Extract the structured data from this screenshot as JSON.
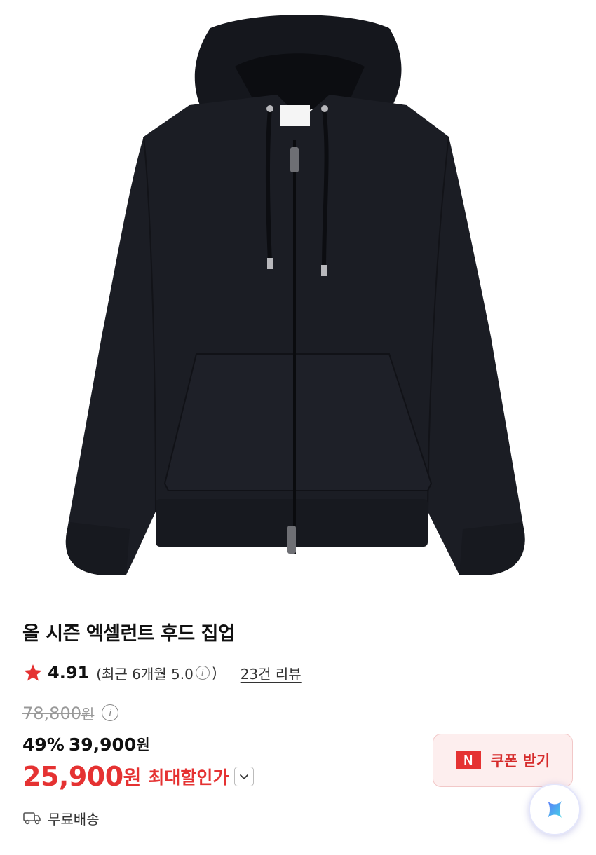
{
  "product": {
    "image_alt": "black zip-up hoodie",
    "title": "올 시즌 엑셀런트 후드 집업"
  },
  "rating": {
    "icon": "star-icon",
    "score": "4.91",
    "recent_prefix": "(최근 6개월 5.0",
    "recent_suffix": ")",
    "info_icon": "info-icon",
    "review_link": "23건 리뷰"
  },
  "price": {
    "original": "78,800",
    "original_currency": "원",
    "discount_percent": "49%",
    "discount_price": "39,900",
    "discount_currency": "원",
    "final_price": "25,900",
    "final_currency": "원",
    "max_discount_label": "최대할인가"
  },
  "shipping": {
    "icon": "truck-icon",
    "label": "무료배송"
  },
  "coupon": {
    "logo_text": "N",
    "label": "쿠폰 받기"
  },
  "colors": {
    "accent_red": "#e53232",
    "coupon_bg": "#fdeeee",
    "hoodie": "#1b1d24"
  }
}
